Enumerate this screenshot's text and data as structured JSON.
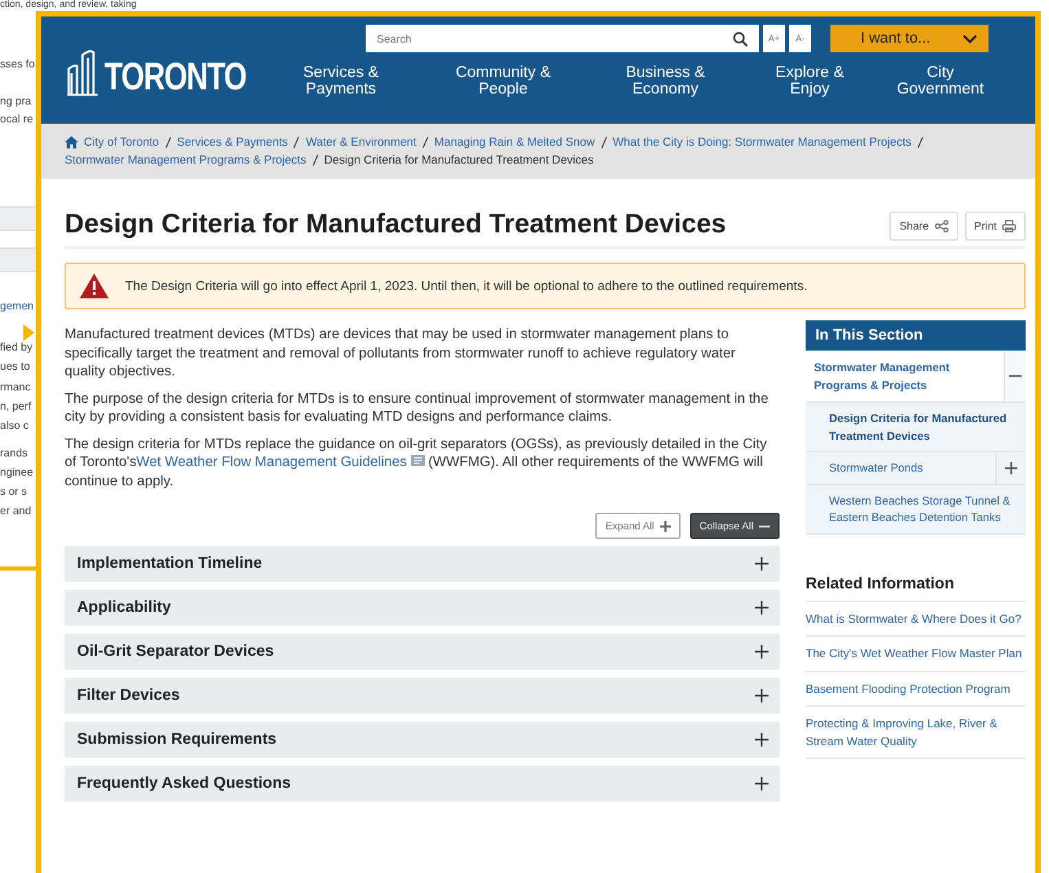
{
  "background_page": {
    "lines": [
      {
        "text": "ction, design, and review, taking",
        "kind": "text"
      },
      {
        "text": "sses fo",
        "kind": "text"
      },
      {
        "text": "ng pra",
        "kind": "text"
      },
      {
        "text": "ocal re",
        "kind": "text"
      },
      {
        "text": "gemen",
        "kind": "link"
      },
      {
        "text": "fied by",
        "kind": "text"
      },
      {
        "text": "ues to",
        "kind": "text"
      },
      {
        "text": "rmanc",
        "kind": "text"
      },
      {
        "text": "n, perf",
        "kind": "text"
      },
      {
        "text": "also c",
        "kind": "text"
      },
      {
        "text": "rands",
        "kind": "text"
      },
      {
        "text": "nginee",
        "kind": "text"
      },
      {
        "text": "s or s",
        "kind": "text"
      },
      {
        "text": "er and",
        "kind": "text"
      }
    ]
  },
  "header": {
    "logo": "TORONTO",
    "search": {
      "placeholder": "Search"
    },
    "font_buttons": [
      "A+",
      "A-"
    ],
    "menu_button": "I want to...",
    "nav": [
      "Services & Payments",
      "Community & People",
      "Business & Economy",
      "Explore & Enjoy",
      "City Government"
    ]
  },
  "breadcrumb": {
    "links": [
      "City of Toronto",
      "Services & Payments",
      "Water & Environment",
      "Managing Rain & Melted Snow",
      "What the City is Doing: Stormwater Management Projects",
      "Stormwater Management Programs & Projects"
    ],
    "current": "Design Criteria for Manufactured Treatment Devices"
  },
  "title": "Design Criteria for Manufactured Treatment Devices",
  "actions": [
    "Share",
    "Print"
  ],
  "alert": "The Design Criteria will go into effect April 1, 2023. Until then, it will be optional to adhere to the outlined requirements.",
  "paragraphs": [
    {
      "text": "Manufactured treatment devices (MTDs) are devices that may be used in stormwater management plans to specifically target the treatment and removal of pollutants from stormwater runoff to achieve regulatory water quality objectives."
    },
    {
      "text": "The purpose of the design criteria for MTDs is to ensure continual improvement of stormwater management in the city by providing a consistent basis for evaluating MTD designs and performance claims."
    },
    {
      "text": "The design criteria for MTDs replace the guidance on oil-grit separators (OGSs), as previously detailed in the City of Toronto's",
      "link": "Wet Weather Flow Management Guidelines",
      "after": "(WWFMG). All other requirements of the WWFMG will continue to apply."
    }
  ],
  "accordion": {
    "expand_all": "Expand All",
    "collapse_all": "Collapse All",
    "sections": [
      {
        "title": "Implementation Timeline",
        "expanded": false
      },
      {
        "title": "Applicability",
        "expanded": false
      },
      {
        "title": "Oil-Grit Separator Devices",
        "expanded": false
      },
      {
        "title": "Filter Devices",
        "expanded": false
      },
      {
        "title": "Submission Requirements",
        "expanded": false
      },
      {
        "title": "Frequently Asked Questions",
        "expanded": false
      }
    ]
  },
  "in_this_section": {
    "title": "In This Section",
    "items": [
      {
        "label": "Stormwater Management Programs & Projects",
        "selected": false,
        "expandable": true,
        "expanded": true,
        "children": [
          {
            "label": "Design Criteria for Manufactured Treatment Devices",
            "selected": true,
            "expandable": false
          },
          {
            "label": "Stormwater Ponds",
            "selected": false,
            "expandable": true,
            "expanded": false
          },
          {
            "label": "Western Beaches Storage Tunnel & Eastern Beaches Detention Tanks",
            "selected": false,
            "expandable": false
          }
        ]
      }
    ]
  },
  "related_information": {
    "title": "Related Information",
    "links": [
      "What is Stormwater & Where Does it Go?",
      "The City's Wet Weather Flow Master Plan",
      "Basement Flooding Protection Program",
      "Protecting & Improving Lake, River & Stream Water Quality"
    ]
  }
}
